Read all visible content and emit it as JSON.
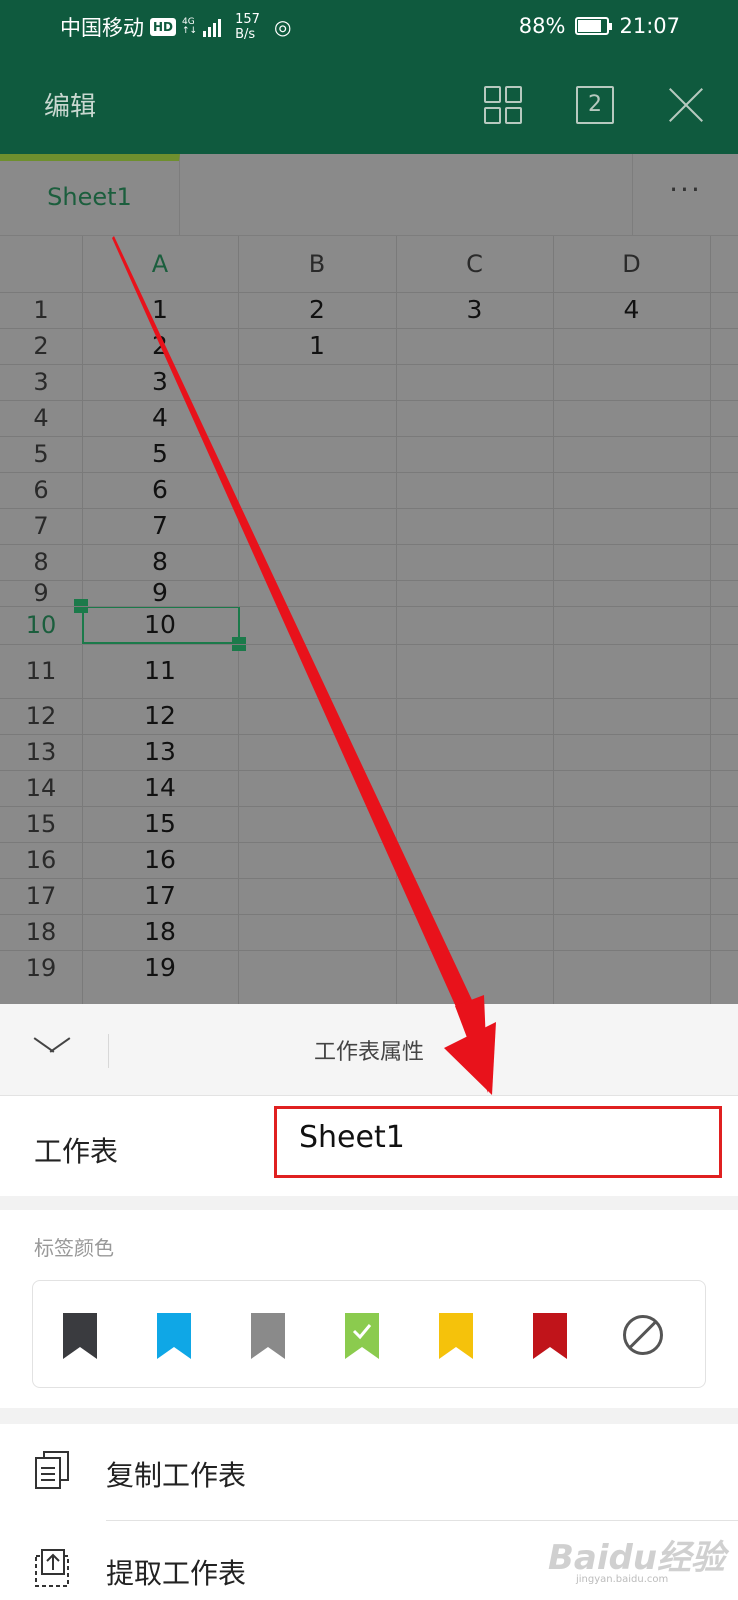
{
  "status_bar": {
    "carrier": "中国移动",
    "hd_badge": "HD",
    "network_type": "4G",
    "speed_value": "157",
    "speed_unit": "B/s",
    "battery_percent": "88%",
    "battery_level": 0.88,
    "time": "21:07"
  },
  "app_bar": {
    "edit_label": "编辑",
    "window_count": "2"
  },
  "sheet_tabs": {
    "active_tab": "Sheet1",
    "more_label": "···"
  },
  "grid": {
    "columns": [
      "A",
      "B",
      "C",
      "D"
    ],
    "rows": [
      "1",
      "2",
      "3",
      "4",
      "5",
      "6",
      "7",
      "8",
      "9",
      "10",
      "11",
      "12",
      "13",
      "14",
      "15",
      "16",
      "17",
      "18",
      "19"
    ],
    "col_a": [
      "1",
      "2",
      "3",
      "4",
      "5",
      "6",
      "7",
      "8",
      "9",
      "10",
      "11",
      "12",
      "13",
      "14",
      "15",
      "16",
      "17",
      "18",
      "19"
    ],
    "row1_b": "2",
    "row1_c": "3",
    "row1_d": "4",
    "row2_b": "1",
    "selected_cell": "A10"
  },
  "panel": {
    "title": "工作表属性",
    "name_label": "工作表",
    "name_value": "Sheet1",
    "tag_color_label": "标签颜色",
    "tag_colors": [
      "#3a3b3f",
      "#0fa7e6",
      "#8a8a8a",
      "#8bcb4e",
      "#f5c20b",
      "#c0141a"
    ],
    "actions": {
      "copy_label": "复制工作表",
      "extract_label": "提取工作表"
    }
  },
  "watermark": {
    "main": "Baidu经验",
    "sub": "jingyan.baidu.com"
  },
  "colors": {
    "brand_green": "#0f5a3e",
    "annotation_red": "#e02020"
  }
}
